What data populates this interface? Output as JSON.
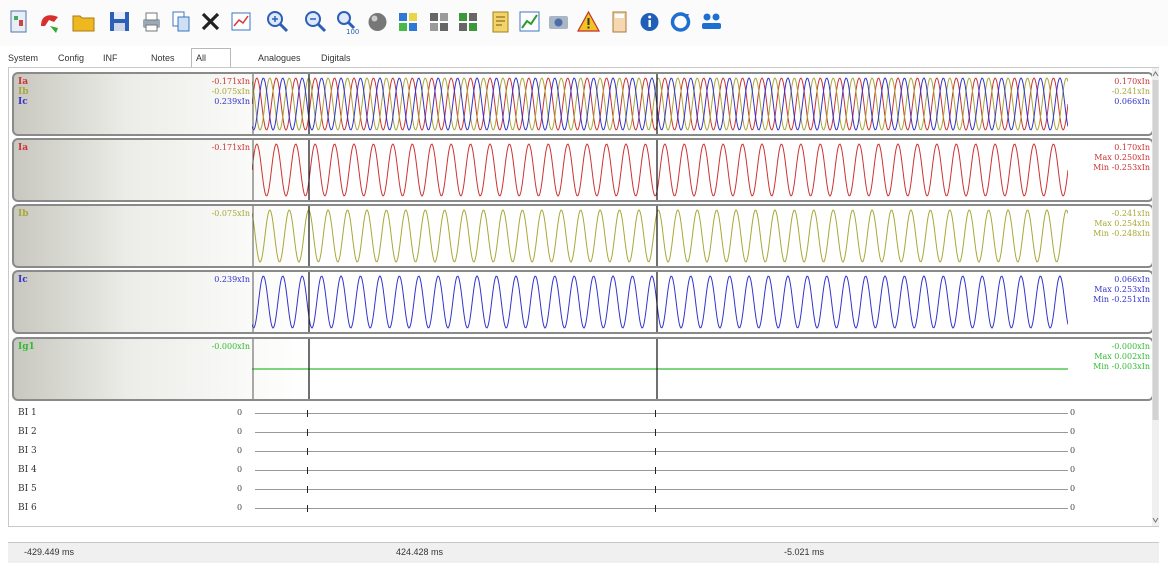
{
  "toolbar": {
    "icons": [
      "summary-icon",
      "open-phone-icon",
      "folder-icon",
      "save-icon",
      "print-icon",
      "copy-icon",
      "close-icon",
      "edit-chart-icon",
      "zoom-in-icon",
      "zoom-out-icon",
      "zoom-100-icon",
      "sphere-icon",
      "grid-icon",
      "layout-icon",
      "layout2-icon",
      "report-icon",
      "chart-icon",
      "camera-icon",
      "warning-icon",
      "calculator-icon",
      "info-icon",
      "refresh-icon",
      "users-icon"
    ]
  },
  "tabs": [
    "System",
    "Config",
    "INF",
    "Notes",
    "All Signals",
    "Analogues",
    "Digitals"
  ],
  "active_tab": "All Signals",
  "colors": {
    "ia": "#cc3333",
    "ib": "#a8a838",
    "ic": "#3333cc",
    "ig": "#33bb33"
  },
  "panels": [
    {
      "id": "combined",
      "labels": [
        "Ia",
        "Ib",
        "Ic"
      ],
      "inst": [
        "-0.171xIn",
        "-0.075xIn",
        "0.239xIn"
      ],
      "right": [
        "0.170xIn",
        "-0.241xIn",
        "0.066xIn"
      ]
    },
    {
      "id": "ia",
      "label": "Ia",
      "inst": "-0.171xIn",
      "right_val": "0.170xIn",
      "max": "Max  0.250xIn",
      "min": "Min  -0.253xIn"
    },
    {
      "id": "ib",
      "label": "Ib",
      "inst": "-0.075xIn",
      "right_val": "-0.241xIn",
      "max": "Max  0.254xIn",
      "min": "Min  -0.248xIn"
    },
    {
      "id": "ic",
      "label": "Ic",
      "inst": "0.239xIn",
      "right_val": "0.066xIn",
      "max": "Max  0.253xIn",
      "min": "Min  -0.251xIn"
    },
    {
      "id": "ig1",
      "label": "Ig1",
      "inst": "-0.000xIn",
      "right_val": "-0.000xIn",
      "max": "Max  0.002xIn",
      "min": "Min  -0.003xIn"
    }
  ],
  "binary_inputs": [
    {
      "label": "BI 1",
      "left": "0",
      "right": "0"
    },
    {
      "label": "BI 2",
      "left": "0",
      "right": "0"
    },
    {
      "label": "BI 3",
      "left": "0",
      "right": "0"
    },
    {
      "label": "BI 4",
      "left": "0",
      "right": "0"
    },
    {
      "label": "BI 5",
      "left": "0",
      "right": "0"
    },
    {
      "label": "BI 6",
      "left": "0",
      "right": "0"
    }
  ],
  "status": {
    "cursor1": "-429.449 ms",
    "cursor2": "424.428 ms",
    "delta": "-5.021 ms"
  }
}
